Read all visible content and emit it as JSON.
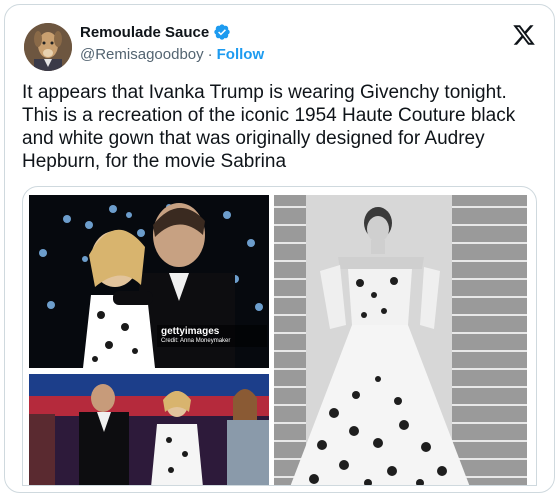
{
  "author": {
    "display_name": "Remoulade Sauce",
    "handle": "@Remisagoodboy",
    "separator": "·",
    "follow_label": "Follow"
  },
  "tweet": {
    "text": "It appears that Ivanka Trump is wearing Givenchy tonight. This is a recreation of the iconic 1954 Haute Couture black and white gown that was originally designed for Audrey Hepburn, for the movie Sabrina"
  },
  "media": {
    "watermark_logo": "gettyimages",
    "watermark_credit": "Credit: Anna Moneymaker"
  },
  "colors": {
    "accent": "#1d9bf0",
    "text_primary": "#0f1419",
    "text_secondary": "#536471",
    "border": "#cfd9de"
  },
  "icons": {
    "verified": "verified-badge-icon",
    "brand": "x-logo-icon"
  }
}
